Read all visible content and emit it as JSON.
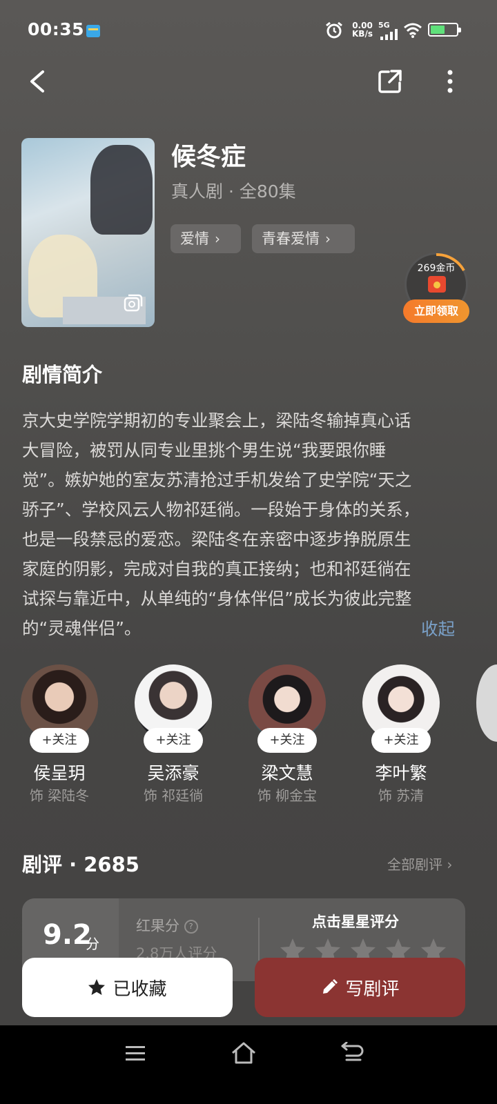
{
  "status_bar": {
    "time": "00:35",
    "net_speed_value": "0.00",
    "net_speed_unit": "KB/s",
    "network": "5G",
    "battery_level": 0.55
  },
  "drama": {
    "title": "候冬症",
    "subtitle": "真人剧 · 全80集",
    "tags": [
      "爱情",
      "青春爱情"
    ]
  },
  "coin_widget": {
    "amount": "269金币",
    "button": "立即领取"
  },
  "synopsis": {
    "heading": "剧情简介",
    "lines": [
      "京大史学院学期初的专业聚会上，梁陆冬输掉真心话",
      "大冒险，被罚从同专业里挑个男生说“我要跟你睡",
      "觉”。嫉妒她的室友苏清抢过手机发给了史学院“天之",
      "骄子”、学校风云人物祁廷徜。一段始于身体的关系，",
      "也是一段禁忌的爱恋。梁陆冬在亲密中逐步挣脱原生",
      "家庭的阴影，完成对自我的真正接纳；也和祁廷徜在",
      "试探与靠近中，从单纯的“身体伴侣”成长为彼此完整",
      "的“灵魂伴侣”。"
    ],
    "collapse_label": "收起"
  },
  "cast": [
    {
      "name": "侯呈玥",
      "role": "饰 梁陆冬",
      "follow": "+关注"
    },
    {
      "name": "吴添豪",
      "role": "饰 祁廷徜",
      "follow": "+关注"
    },
    {
      "name": "梁文慧",
      "role": "饰 柳金宝",
      "follow": "+关注"
    },
    {
      "name": "李叶繁",
      "role": "饰 苏清",
      "follow": "+关注"
    }
  ],
  "reviews": {
    "heading": "剧评 · 2685",
    "all_label": "全部剧评",
    "score": "9.2",
    "score_unit": "分",
    "rating_source": "红果分",
    "rating_count": "2.8万人评分",
    "tap_to_rate": "点击星星评分"
  },
  "actions": {
    "favorite_label": "已收藏",
    "write_review_label": "写剧评"
  },
  "colors": {
    "accent_red": "#8b3432",
    "link_blue": "#7aa1c9",
    "coin_orange": "#f57a2b"
  }
}
